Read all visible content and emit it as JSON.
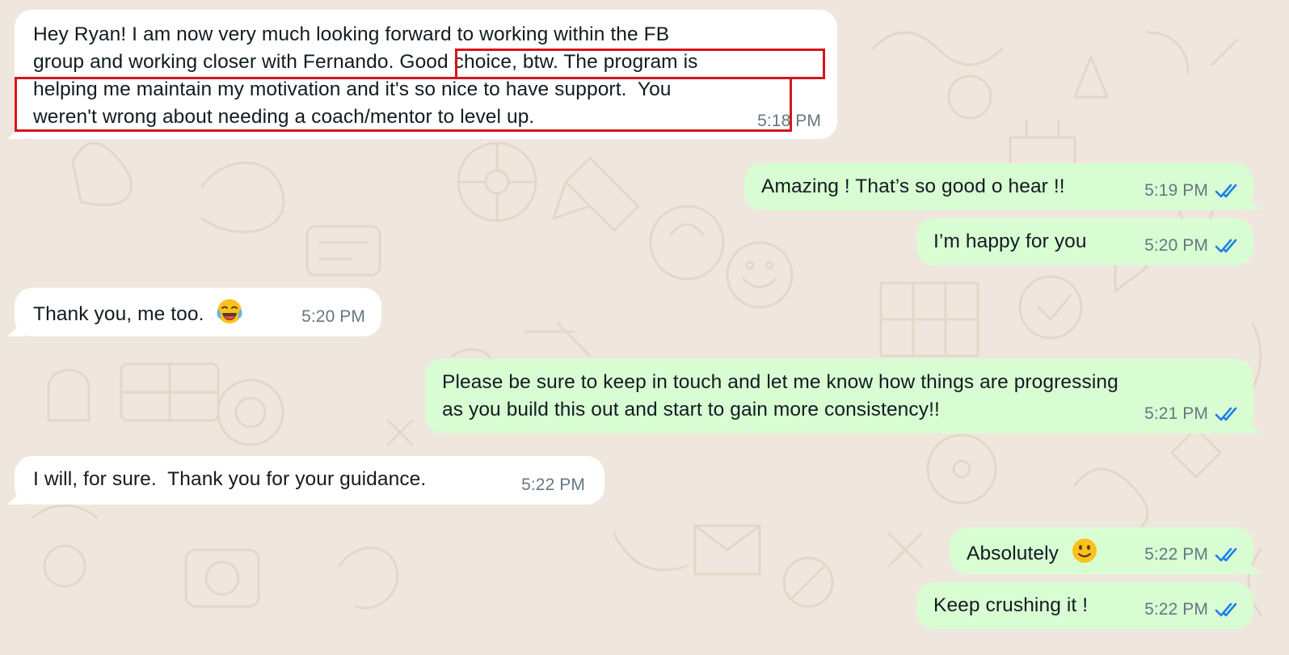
{
  "chat": {
    "messages": [
      {
        "id": "m1",
        "direction": "incoming",
        "lines": [
          "Hey Ryan! I am now very much looking forward to working within the FB",
          "group and working closer with Fernando. Good choice, btw. The program is",
          "helping me maintain my motivation and it's so nice to have support.  You",
          "weren't wrong about needing a coach/mentor to level up."
        ],
        "time": "5:18 PM"
      },
      {
        "id": "m2",
        "direction": "outgoing",
        "text": "Amazing ! That’s so good o hear !!",
        "time": "5:19 PM",
        "status": "read"
      },
      {
        "id": "m3",
        "direction": "outgoing",
        "text": "I’m happy for you",
        "time": "5:20 PM",
        "status": "read"
      },
      {
        "id": "m4",
        "direction": "incoming",
        "text": "Thank you, me too.",
        "emoji": "face-with-tears-of-joy",
        "time": "5:20 PM"
      },
      {
        "id": "m5",
        "direction": "outgoing",
        "lines": [
          "Please be sure to keep in touch and let me know how things are progressing",
          "as you build this out and start to gain more consistency!!"
        ],
        "time": "5:21 PM",
        "status": "read"
      },
      {
        "id": "m6",
        "direction": "incoming",
        "text": "I will, for sure.  Thank you for your guidance.",
        "time": "5:22 PM"
      },
      {
        "id": "m7",
        "direction": "outgoing",
        "text": "Absolutely",
        "emoji": "slightly-smiling-face",
        "time": "5:22 PM",
        "status": "read"
      },
      {
        "id": "m8",
        "direction": "outgoing",
        "text": "Keep crushing it !",
        "time": "5:22 PM",
        "status": "read"
      }
    ]
  },
  "colors": {
    "wallpaper": "#efe7dd",
    "incoming_bubble": "#ffffff",
    "outgoing_bubble": "#d9fdd3",
    "read_ticks": "#1f7ee8",
    "highlight_box": "#d8141c",
    "meta_text": "#667781"
  },
  "icons": {
    "read_receipt": "double-check-icon",
    "wallpaper": "doodle-pattern"
  }
}
